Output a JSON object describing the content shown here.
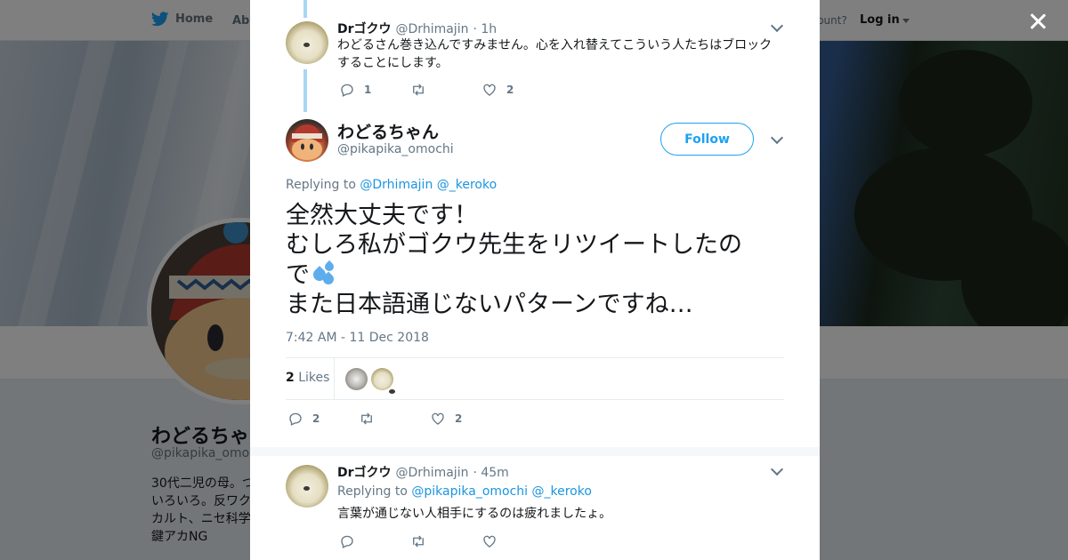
{
  "nav": {
    "home_label": "Home",
    "about_label": "Abo",
    "account_prompt": "ccount?",
    "login_label": "Log in"
  },
  "profile": {
    "name": "わどるちゃ",
    "handle": "@pikapika_omoch",
    "bio_lines": [
      "30代二児の母。つ",
      "いろいろ。反ワク",
      "カルト、ニセ科学",
      "鍵アカNG"
    ]
  },
  "thread": {
    "tweet_prev": {
      "name": "Drゴクウ",
      "handle": "@Drhimajin",
      "time": "· 1h",
      "text": "わどるさん巻き込んですみません。心を入れ替えてこういう人たちはブロックすることにします。",
      "reply_count": "1",
      "retweet_count": "",
      "like_count": "2"
    },
    "main_tweet": {
      "name": "わどるちゃん",
      "handle": "@pikapika_omochi",
      "follow_label": "Follow",
      "replying_label": "Replying to",
      "replying_to_1": "@Drhimajin",
      "replying_to_2": "@_keroko",
      "text_line1": "全然大丈夫です！",
      "text_line2": "むしろ私がゴクウ先生をリツイートしたの",
      "text_line3": "で",
      "text_line4": "また日本語通じないパターンですね…",
      "timestamp": "7:42 AM - 11 Dec 2018",
      "likes_number": "2",
      "likes_label": "Likes",
      "reply_count": "2",
      "retweet_count": "",
      "like_count": "2"
    },
    "tweet_reply": {
      "name": "Drゴクウ",
      "handle": "@Drhimajin",
      "time": "· 45m",
      "replying_label": "Replying to",
      "replying_to_1": "@pikapika_omochi",
      "replying_to_2": "@_keroko",
      "text": "言葉が通じない人相手にするのは疲れましたょ。",
      "reply_count": "",
      "retweet_count": "",
      "like_count": ""
    }
  },
  "icons": {
    "bird": "twitter-bird-icon",
    "reply": "reply-icon",
    "retweet": "retweet-icon",
    "like": "heart-icon",
    "more": "chevron-down-icon",
    "close": "close-icon",
    "emoji": "sweat-droplets-icon"
  },
  "colors": {
    "brand": "#1da1f2",
    "link": "#1b95e0",
    "thread_line": "#a9d5f6",
    "muted": "#657786",
    "overlay": "rgba(0,0,0,0.5)"
  }
}
